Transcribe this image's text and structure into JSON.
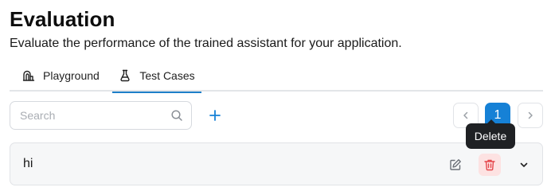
{
  "header": {
    "title": "Evaluation",
    "subtitle": "Evaluate the performance of the trained assistant for your application."
  },
  "tabs": [
    {
      "label": "Playground",
      "icon": "playground-icon",
      "active": false
    },
    {
      "label": "Test Cases",
      "icon": "flask-icon",
      "active": true
    }
  ],
  "toolbar": {
    "search_placeholder": "Search",
    "search_value": "",
    "add_icon": "plus-icon"
  },
  "pagination": {
    "current_page": "1",
    "prev_icon": "chevron-left-icon",
    "next_icon": "chevron-right-icon"
  },
  "tooltip": {
    "text": "Delete"
  },
  "test_cases": [
    {
      "title": "hi"
    }
  ],
  "colors": {
    "accent": "#1681d6",
    "tab_underline": "#1e7fc9",
    "delete_bg": "#fde2e2",
    "delete_icon": "#e5484d",
    "tooltip_bg": "#1f2124"
  }
}
